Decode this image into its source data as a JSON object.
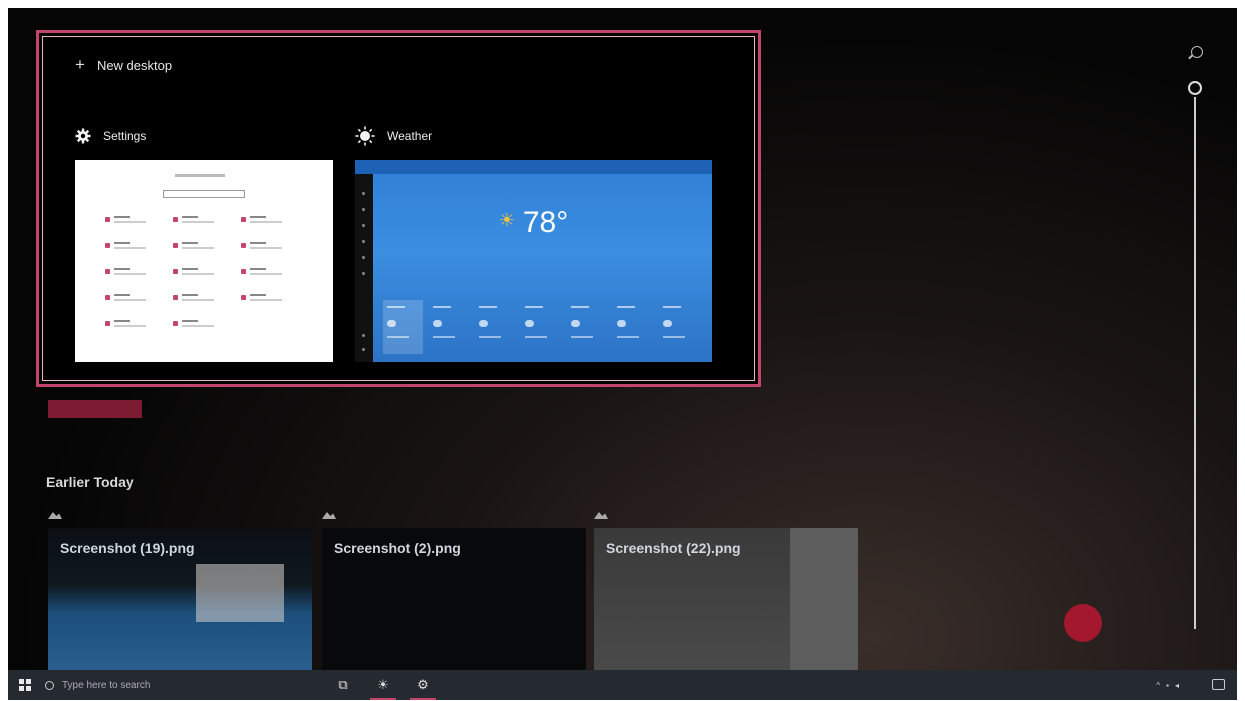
{
  "task_view": {
    "new_desktop_label": "New desktop",
    "windows": [
      {
        "label": "Settings",
        "icon": "gear-icon"
      },
      {
        "label": "Weather",
        "icon": "sun-icon"
      }
    ],
    "weather_preview": {
      "temperature": "78°"
    }
  },
  "activity_history": {
    "section_title": "Earlier Today",
    "cards": [
      {
        "title": "Screenshot (19).png"
      },
      {
        "title": "Screenshot (2).png"
      },
      {
        "title": "Screenshot (22).png"
      }
    ]
  },
  "taskbar": {
    "search_placeholder": "Type here to search"
  },
  "colors": {
    "accent": "#c2456c",
    "taskbar": "#252a30",
    "weather_blue": "#2f7fd6"
  }
}
